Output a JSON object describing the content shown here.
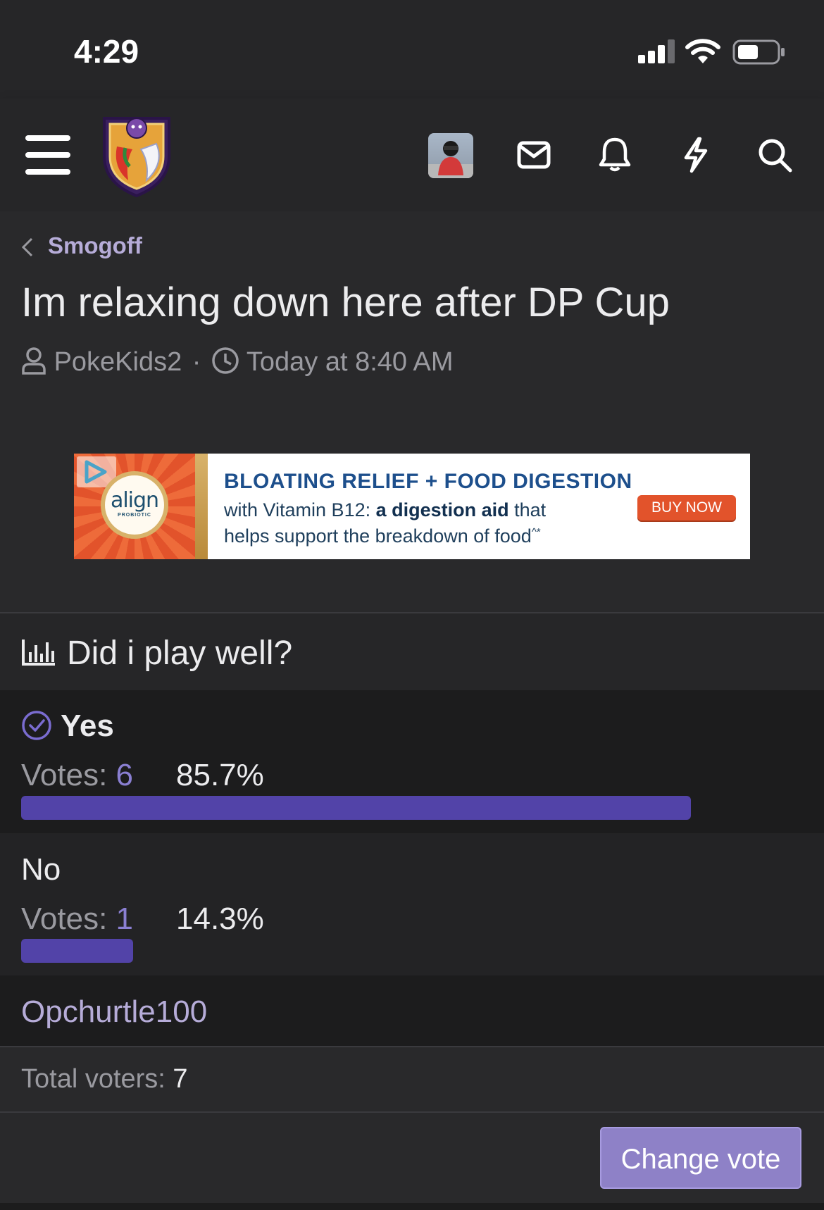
{
  "status_bar": {
    "time": "4:29"
  },
  "header": {
    "site_logo": "shield-logo",
    "icons": [
      "menu-icon",
      "avatar",
      "envelope-icon",
      "bell-icon",
      "bolt-icon",
      "search-icon"
    ]
  },
  "breadcrumb": {
    "label": "Smogoff"
  },
  "thread": {
    "title": "Im relaxing down here after DP Cup",
    "author": "PokeKids2",
    "separator": "·",
    "date": "Today at 8:40 AM"
  },
  "ad": {
    "brand": "align",
    "brand_sub": "PROBIOTIC",
    "headline": "BLOATING RELIEF + FOOD DIGESTION",
    "line1_pre": "with Vitamin B12: ",
    "line1_bold": "a digestion aid",
    "line1_post": " that",
    "line2": "helps support the breakdown of food",
    "line2_mark": "^*",
    "button": "BUY NOW"
  },
  "poll": {
    "question": "Did i play well?",
    "votes_label": "Votes: ",
    "options": [
      {
        "label": "Yes",
        "votes": "6",
        "percent": "85.7%",
        "fraction": 0.857,
        "selected": true
      },
      {
        "label": "No",
        "votes": "1",
        "percent": "14.3%",
        "fraction": 0.143,
        "selected": false
      }
    ],
    "voter": "Opchurtle100",
    "total_label": "Total voters: ",
    "total": "7",
    "change_button": "Change vote"
  },
  "colors": {
    "accent": "#5243a8",
    "button": "#8e81c7",
    "link": "#b6acd8"
  }
}
